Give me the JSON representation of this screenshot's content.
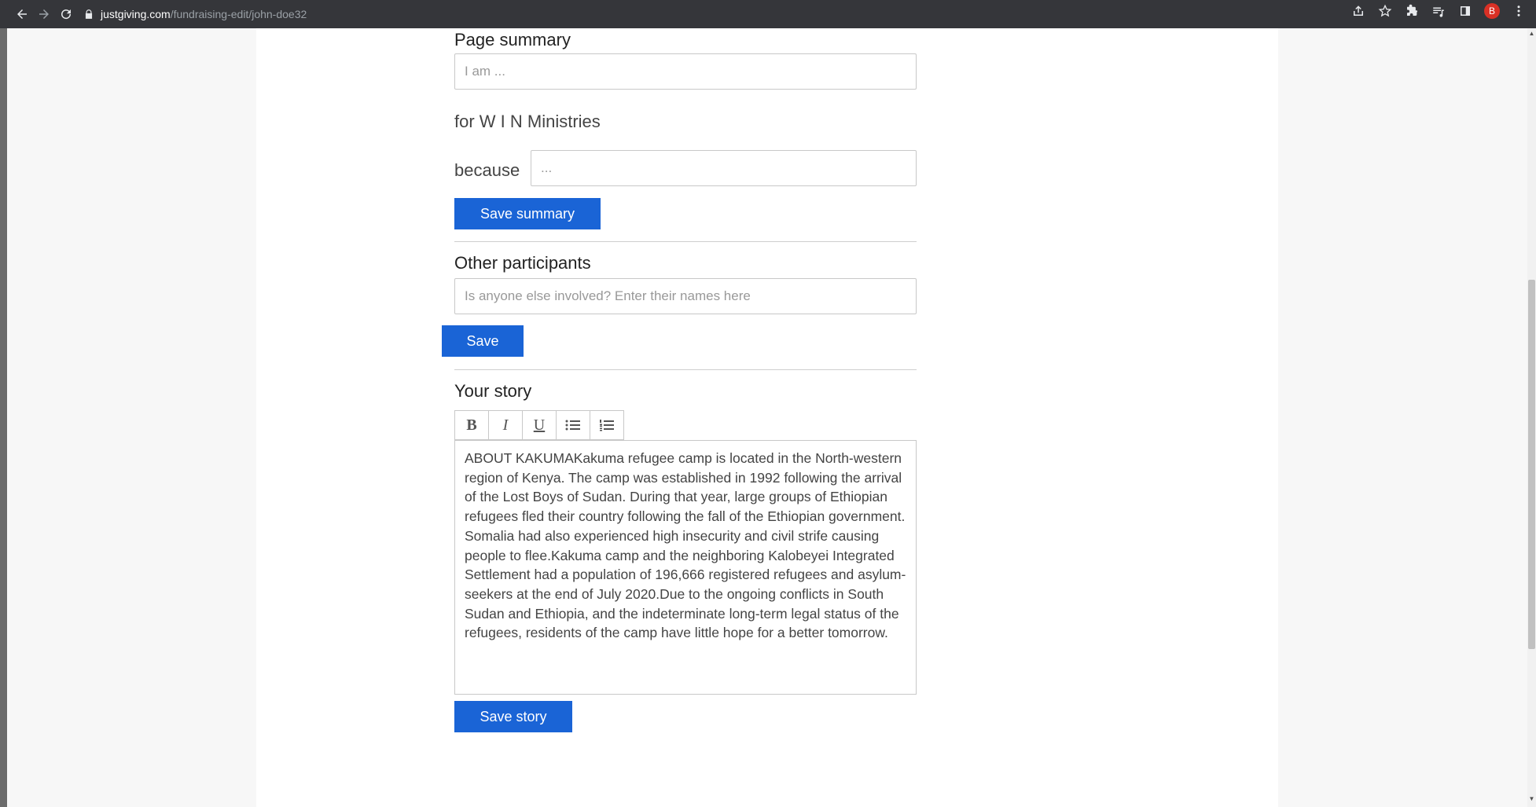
{
  "browser": {
    "url_host": "justgiving.com",
    "url_path": "/fundraising-edit/john-doe32",
    "avatar_letter": "B"
  },
  "page_summary": {
    "title": "Page summary",
    "input_placeholder": "I am ...",
    "for_text": "for W I N Ministries",
    "because_label": "because",
    "because_placeholder": "...",
    "save_label": "Save summary"
  },
  "other_participants": {
    "title": "Other participants",
    "input_placeholder": "Is anyone else involved? Enter their names here",
    "save_label": "Save"
  },
  "your_story": {
    "title": "Your story",
    "toolbar": {
      "bold": "B",
      "italic": "I",
      "underline": "U"
    },
    "text": "ABOUT KAKUMAKakuma refugee camp is located in the North-western region of Kenya. The camp was established in 1992 following the arrival of the Lost Boys of Sudan. During that year, large groups of Ethiopian refugees fled their country following the fall of the Ethiopian government. Somalia had also experienced high insecurity and civil strife causing people to flee.Kakuma camp and the neighboring Kalobeyei Integrated Settlement had a population of 196,666 registered refugees and asylum-seekers at the end of July 2020.Due to the ongoing conflicts in South Sudan and Ethiopia, and the indeterminate long-term legal status of the refugees, residents of the camp have little hope for a better tomorrow.",
    "save_label": "Save story"
  },
  "colors": {
    "primary_button": "#1a64d6",
    "chrome_bar": "#35363a"
  }
}
